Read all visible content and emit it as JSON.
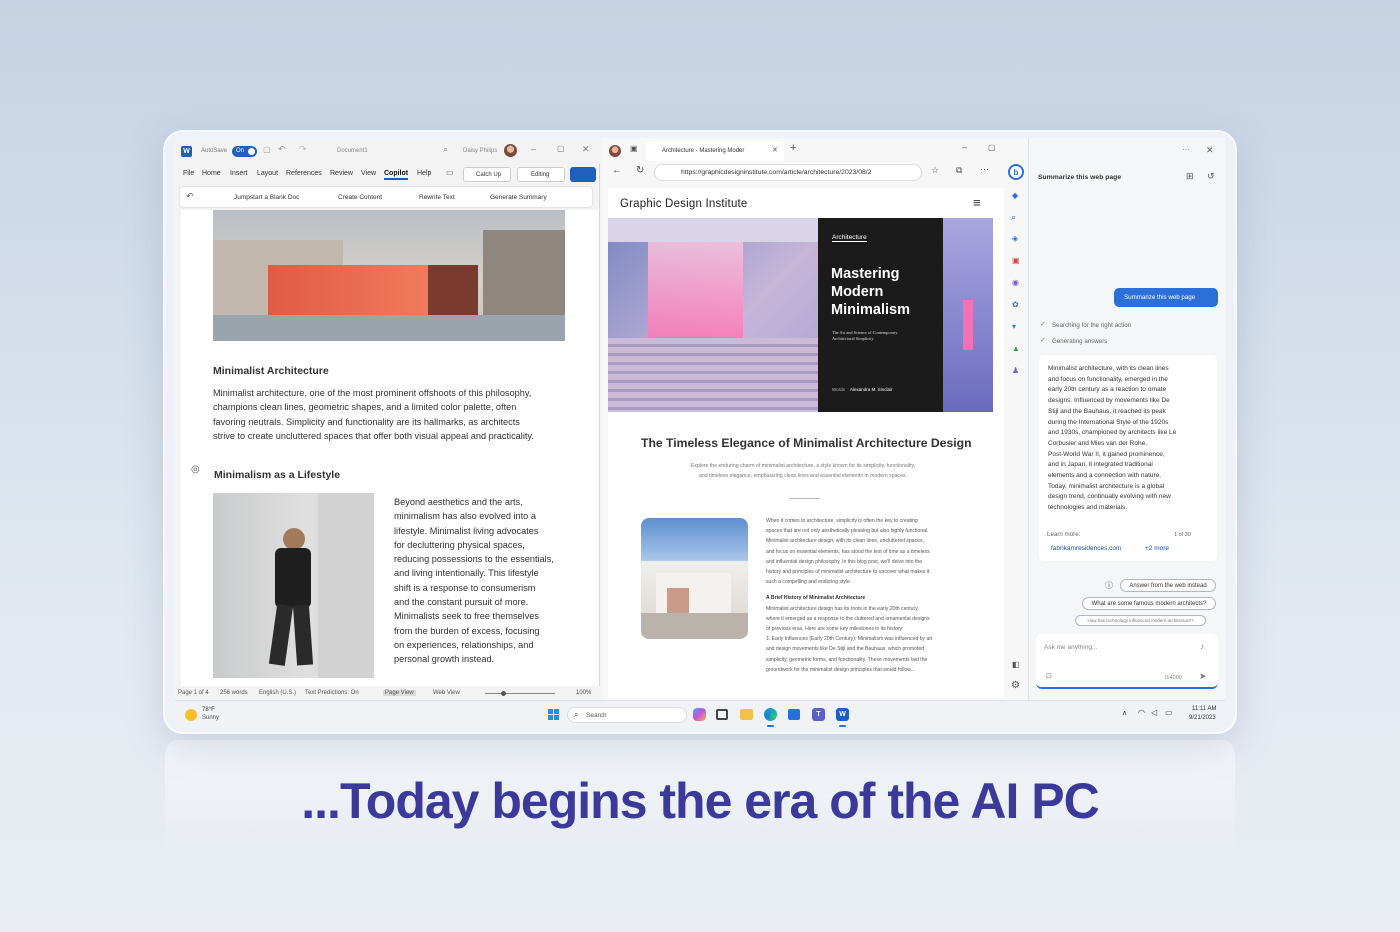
{
  "word": {
    "autosave_label": "AutoSave",
    "autosave_state": "On",
    "doc_name": "Document1",
    "user_name": "Daisy Philips",
    "menu": [
      "File",
      "Home",
      "Insert",
      "Layout",
      "References",
      "Review",
      "View",
      "Copilot",
      "Help"
    ],
    "catch_up": "Catch Up",
    "editing": "Editing",
    "ribbon": [
      "Jumpstart a Blank Doc",
      "Create Content",
      "Rewrite Text",
      "Generate Summary"
    ],
    "section1_title": "Minimalist Architecture",
    "section1_lines": [
      "Minimalist architecture, one of the most prominent offshoots of this philosophy,",
      "champions clean lines, geometric shapes, and a limited color palette, often",
      "favoring neutrals. Simplicity and functionality are its hallmarks, as architects",
      "strive to create uncluttered spaces that offer both visual appeal and practicality."
    ],
    "section2_title": "Minimalism as a Lifestyle",
    "section2_lines": [
      "Beyond aesthetics and the arts,",
      "minimalism has also evolved into a",
      "lifestyle. Minimalist living advocates",
      "for decluttering physical spaces,",
      "reducing possessions to the essentials,",
      "and living intentionally. This lifestyle",
      "shift is a response to consumerism",
      "and the constant pursuit of more.",
      "Minimalists seek to free themselves",
      "from the burden of excess, focusing",
      "on experiences, relationships, and",
      "personal growth instead."
    ],
    "status": {
      "page": "Page 1 of 4",
      "words": "256 words",
      "lang": "English (U.S.)",
      "predictions": "Text Predictions: On",
      "page_view": "Page View",
      "web_view": "Web View",
      "zoom": "100%"
    }
  },
  "edge": {
    "tab_title": "Architecture - Mastering Moder",
    "url": "https://graphicdesigninstitute.com/article/architecture/2023/08/2",
    "site_name": "Graphic Design Institute",
    "hero_tag": "Architecture",
    "hero_title": [
      "Mastering",
      "Modern",
      "Minimalism"
    ],
    "hero_sub": [
      "The Art and Science of Contemporary",
      "Architectural Simplicity"
    ],
    "hero_words_label": "Words",
    "hero_author": "Alexandra M. Sinclair",
    "article_title": "The Timeless Elegance of Minimalist Architecture Design",
    "article_intro": [
      "Explore the enduring charm of minimalist architecture, a style known for its simplicity, functionality,",
      "and timeless elegance, emphasizing clean lines and essential elements in modern spaces."
    ],
    "body1": [
      "When it comes to architecture, simplicity is often the key to creating",
      "spaces that are not only aesthetically pleasing but also highly functional.",
      "Minimalist architecture design, with its clean lines, uncluttered spaces,",
      "and focus on essential elements, has stood the test of time as a timeless",
      "and influential design philosophy. In this blog post, we'll delve into the",
      "history and principles of minimalist architecture to uncover what makes it",
      "such a compelling and enduring style."
    ],
    "subhead": "A Brief History of Minimalist Architecture",
    "body2": [
      "Minimalist architecture design has its roots in the early 20th century,",
      "where it emerged as a response to the cluttered and ornamental designs",
      "of previous eras. Here are some key milestones in its history:",
      "1. Early Influences (Early 20th Century): Minimalism was influenced by art",
      "and design movements like De Stijl and the Bauhaus, which promoted",
      "simplicity, geometric forms, and functionality. These movements laid the",
      "groundwork for the minimalist design principles that would follow..."
    ]
  },
  "copilot": {
    "header": "Summarize this web page",
    "user_bubble": "Summarize this web page",
    "steps": [
      "Searching for the right action",
      "Generating answers"
    ],
    "answer_lines": [
      "Minimalist architecture, with its clean lines",
      "and focus on functionality, emerged in the",
      "early 20th century as a reaction to ornate",
      "designs. Influenced by movements like De",
      "Stijl and the Bauhaus, it reached its peak",
      "during the International Style of the 1920s",
      "and 1930s, championed by architects like Le",
      "Corbusier and Mies van der Rohe.",
      "Post-World War II, it gained prominence,",
      "and in Japan, it integrated traditional",
      "elements and a connection with nature.",
      "Today, minimalist architecture is a global",
      "design trend, continually evolving with new",
      "technologies and materials."
    ],
    "learn_more": "Learn more:",
    "page_count": "1 of 30",
    "source_link": "fabrikamresidences.com",
    "more_link": "+2 more",
    "suggestions": [
      "Answer from the web instead",
      "What are some famous modern architects?",
      "How has technology influenced modern architecture?"
    ],
    "input_placeholder": "Ask me anything...",
    "char_count": "0/4000"
  },
  "taskbar": {
    "temp": "78°F",
    "weather": "Sunny",
    "search_placeholder": "Search",
    "time": "11:11 AM",
    "date": "9/21/2023"
  },
  "headline": "...Today begins the era of the AI PC",
  "colors": {
    "accent": "#2b6fd8",
    "word_blue": "#1f5fbf",
    "headline": "#3b3a9a"
  }
}
